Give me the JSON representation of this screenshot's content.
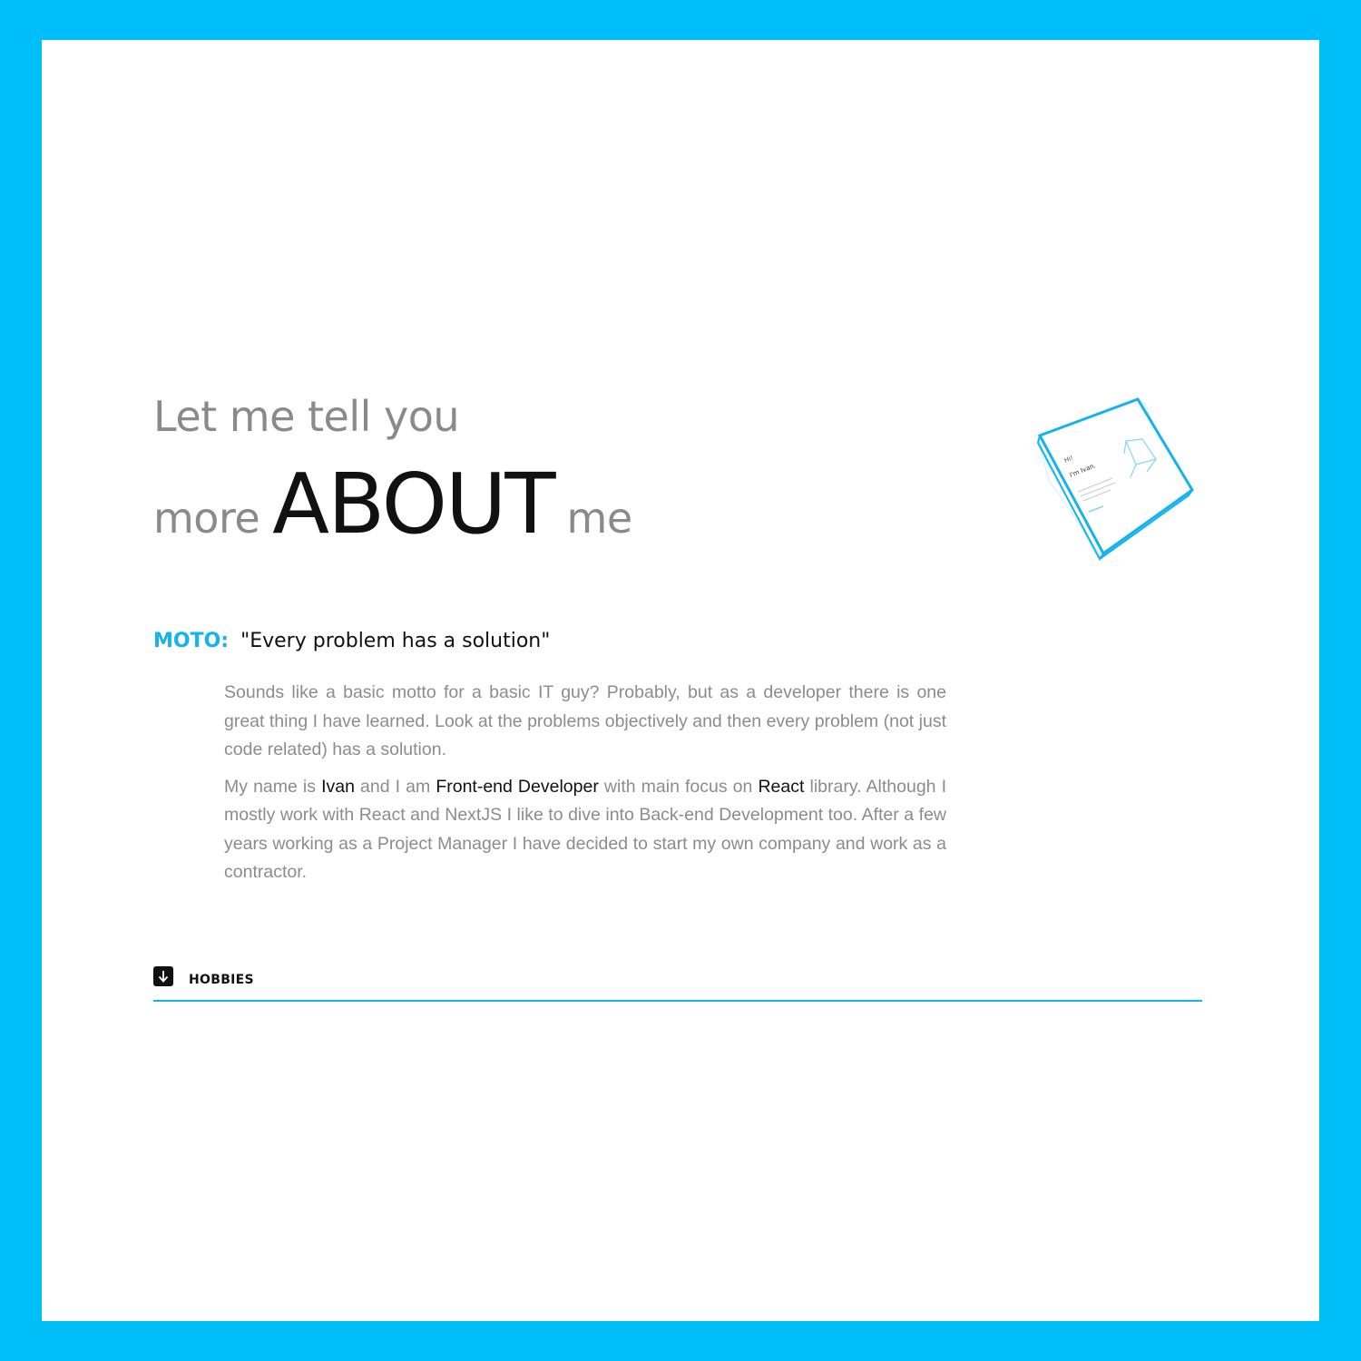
{
  "heading": {
    "line1": "Let me tell you",
    "pre": "more",
    "emphasis": "ABOUT",
    "post": "me"
  },
  "moto": {
    "label": "MOTO:",
    "text": "\"Every problem has a solution\""
  },
  "paragraph1": "Sounds like a basic motto for a basic IT guy? Probably, but as a developer there is one great thing I have learned. Look at the problems objectively and then every problem (not just code related) has a solution.",
  "paragraph2": {
    "t1": "My name is ",
    "name": "Ivan",
    "t2": " and I am ",
    "role": "Front-end Developer",
    "t3": " with main focus on ",
    "lib": "React",
    "t4": " library. Although I mostly work with React and NextJS I like to dive into Back-end Development too. After a few years working as a Project Manager I have decided to start my own company and work as a contractor."
  },
  "hobbies": {
    "icon": "arrow-down-icon",
    "label": "HOBBIES"
  },
  "cube_card": {
    "greeting": "Hi!",
    "intro": "I'm Ivan."
  },
  "colors": {
    "frame": "#00bff8",
    "accent": "#14b3ef",
    "text_muted": "#8c8c8c",
    "text_dark": "#111111"
  }
}
